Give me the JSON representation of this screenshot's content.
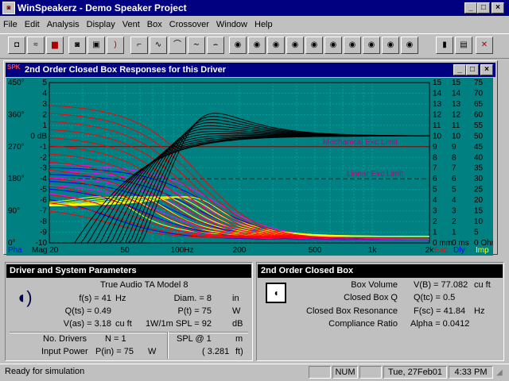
{
  "app": {
    "title": "WinSpeakerz - Demo Speaker Project"
  },
  "menu": [
    "File",
    "Edit",
    "Analysis",
    "Display",
    "Vent",
    "Box",
    "Crossover",
    "Window",
    "Help"
  ],
  "child": {
    "title": "2nd Order Closed Box Responses for this Driver"
  },
  "axes": {
    "left_deg": [
      "450°",
      "360°",
      "270°",
      "180°",
      "90°",
      "0°"
    ],
    "left_db": [
      "5",
      "4",
      "3",
      "2",
      "1",
      "0 dB",
      "-1",
      "-2",
      "-3",
      "-4",
      "-5",
      "-6",
      "-7",
      "-8",
      "-9",
      "-10"
    ],
    "right1": [
      "15",
      "14",
      "13",
      "12",
      "11",
      "10",
      "9",
      "8",
      "7",
      "6",
      "5",
      "4",
      "3",
      "2",
      "1",
      "0 mm"
    ],
    "right2": [
      "15",
      "14",
      "13",
      "12",
      "11",
      "10",
      "9",
      "8",
      "7",
      "6",
      "5",
      "4",
      "3",
      "2",
      "1",
      "0 ms"
    ],
    "right3": [
      "75",
      "70",
      "65",
      "60",
      "55",
      "50",
      "45",
      "40",
      "35",
      "30",
      "25",
      "20",
      "15",
      "10",
      "5",
      "0 Ohm"
    ],
    "x_ticks": [
      "Mag 20",
      "50",
      "100Hz",
      "200",
      "500",
      "1k",
      "2k"
    ],
    "bottom_left": "Pha",
    "bottom_right": [
      "Exc",
      "Dly",
      "Imp"
    ]
  },
  "annotations": {
    "mech": "Mechanical Exc Limit",
    "linear": "Linear Exc Limit"
  },
  "driver_panel": {
    "title": "Driver and System Parameters",
    "model": "True Audio TA Model 8",
    "rows": [
      {
        "l": "f(s) = 41",
        "u": "Hz",
        "r": "Diam. = 8",
        "ru": "in"
      },
      {
        "l": "Q(ts) = 0.49",
        "u": "",
        "r": "P(t) = 75",
        "ru": "W"
      },
      {
        "l": "V(as) = 3.18",
        "u": "cu ft",
        "r": "1W/1m SPL = 92",
        "ru": "dB"
      }
    ],
    "no_drivers_label": "No. Drivers",
    "no_drivers": "N = 1",
    "input_power_label": "Input Power",
    "input_power": "P(in) = 75",
    "input_power_unit": "W",
    "spl_label": "SPL @ 1",
    "spl_unit": "m",
    "spl_value": "( 3.281",
    "spl_value_unit": "ft)"
  },
  "box_panel": {
    "title": "2nd Order Closed Box",
    "rows": [
      {
        "label": "Box Volume",
        "value": "V(B) = 77.082",
        "unit": "cu ft"
      },
      {
        "label": "Closed Box Q",
        "value": "Q(tc) = 0.5",
        "unit": ""
      },
      {
        "label": "Closed Box Resonance",
        "value": "F(sc) = 41.84",
        "unit": "Hz"
      },
      {
        "label": "Compliance Ratio",
        "value": "Alpha = 0.0412",
        "unit": ""
      }
    ]
  },
  "status": {
    "text": "Ready for simulation",
    "num": "NUM",
    "date": "Tue, 27Feb01",
    "time": "4:33 PM"
  },
  "colors": {
    "title": "#000080",
    "plot_bg": "#008080",
    "grid": "#00a0a0",
    "mag": "#000000",
    "exc": "#ff0000",
    "phase": "#0000ff",
    "delay": "#ff00ff",
    "imp": "#ffff00"
  }
}
